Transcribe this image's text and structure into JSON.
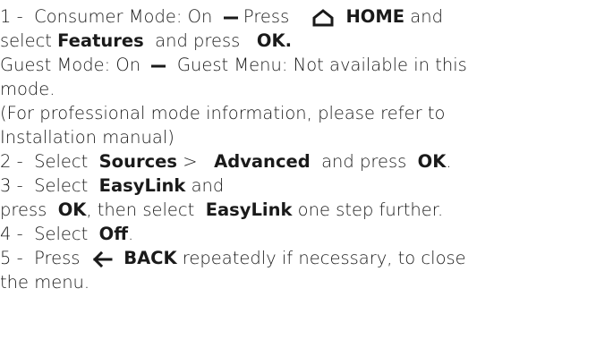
{
  "instructions": {
    "l1": {
      "num": "1 -",
      "mode": "Consumer Mode: On",
      "press": "Press",
      "home": "HOME",
      "and": "and"
    },
    "l2": {
      "select": "select",
      "features": "Features",
      "and_press": "and press",
      "ok": "OK."
    },
    "l3": {
      "mode": "Guest Mode: On",
      "text": "Guest Menu: Not available in this"
    },
    "l4": {
      "text": "mode."
    },
    "l5": {
      "text": "(For professional mode information, please refer to"
    },
    "l6": {
      "text": "Installation manual)"
    },
    "l7": {
      "num": "2 -",
      "select": "Select",
      "sources": "Sources",
      "sep": ">",
      "advanced": "Advanced",
      "and_press": "and press",
      "ok": "OK",
      "end": "."
    },
    "l8": {
      "num": "3 -",
      "select": "Select",
      "easylink": "EasyLink",
      "and": "and"
    },
    "l9": {
      "press": "press",
      "ok": "OK",
      "then": ", then select",
      "easylink": "EasyLink",
      "rest": "one step further."
    },
    "l10": {
      "num": "4 -",
      "select": "Select",
      "off": "Off",
      "end": "."
    },
    "l11": {
      "num": "5 -",
      "press": "Press",
      "back": "BACK",
      "rest": "repeatedly if necessary, to close"
    },
    "l12": {
      "text": "the menu."
    }
  },
  "icons": {
    "home": "home-icon",
    "back": "back-arrow-icon",
    "dash": "dash-icon"
  }
}
